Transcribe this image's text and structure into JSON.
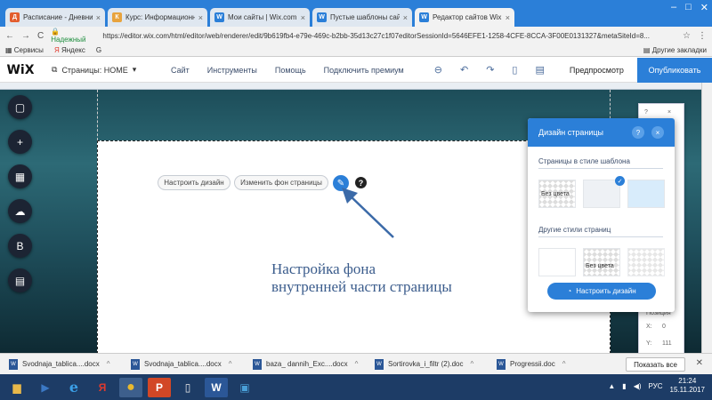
{
  "browser": {
    "tabs": [
      {
        "title": "Расписание - Дневник.р",
        "icon": "diary-icon",
        "color": "#e35d2e"
      },
      {
        "title": "Курс: Информационно",
        "icon": "course-icon",
        "color": "#e8a33d"
      },
      {
        "title": "Мои сайты | Wix.com",
        "icon": "wix-icon",
        "color": "#2b7fd8"
      },
      {
        "title": "Пустые шаблоны сайто",
        "icon": "wix-icon",
        "color": "#2b7fd8"
      },
      {
        "title": "Редактор сайтов Wix",
        "icon": "wix-icon",
        "color": "#2b7fd8",
        "active": true
      }
    ],
    "tab_close": "×",
    "window_controls": [
      "–",
      "□",
      "✕"
    ],
    "nav": {
      "back": "←",
      "forward": "→",
      "reload": "C"
    },
    "secure_label": "Надежный",
    "url": "https://editor.wix.com/html/editor/web/renderer/edit/9b619fb4-e79e-469c-b2bb-35d13c27c1f07editorSessionId=5646EFE1-1258-4CFE-8CCA-3F00E0131327&metaSiteId=8...",
    "star": "☆",
    "menu": "⋮",
    "bookmarks": {
      "apps": "Сервисы",
      "yandex": "Яндекс",
      "google": "G",
      "other": "Другие закладки"
    }
  },
  "wix": {
    "logo": "WiX",
    "pages_label": "Страницы: HOME",
    "pages_chevron": "▾",
    "menu": [
      "Сайт",
      "Инструменты",
      "Помощь",
      "Подключить премиум"
    ],
    "tools": [
      "⊖",
      "↶",
      "↷",
      "▯",
      "▤"
    ],
    "preview": "Предпросмотр",
    "publish": "Опубликовать"
  },
  "canvas": {
    "left_rail": [
      {
        "name": "background-tool-icon",
        "glyph": "▢"
      },
      {
        "name": "add-icon",
        "glyph": "+"
      },
      {
        "name": "app-market-icon",
        "glyph": "▦"
      },
      {
        "name": "upload-icon",
        "glyph": "☁"
      },
      {
        "name": "blog-icon",
        "glyph": "B"
      },
      {
        "name": "calendar-icon",
        "glyph": "▤"
      }
    ],
    "customize_design_pill": "Настроить дизайн",
    "change_bg_pill": "Изменить фон страницы",
    "edit_glyph": "✎",
    "help_glyph": "?",
    "annotation_line1": "Настройка фона",
    "annotation_line2": "внутренней части страницы",
    "accent": "#2b7fd8",
    "mini_panel": {
      "q": "?",
      "x": "×",
      "position": "Позиция",
      "x_label": "X:",
      "x_value": "0",
      "y_label": "Y:",
      "y_value": "111"
    }
  },
  "design_panel": {
    "title": "Дизайн страницы",
    "help": "?",
    "close": "×",
    "section1": "Страницы в стиле шаблона",
    "section2": "Другие стили страниц",
    "no_color_label": "Без цвета",
    "check": "✓",
    "button": "Настроить дизайн",
    "button_icon": "◔"
  },
  "downloads": {
    "items": [
      "Svodnaja_tablica....docx",
      "Svodnaja_tablica....docx",
      "baza_ dannih_Exc....docx",
      "Sortirovka_i_filtr (2).doc",
      "Progressii.doc"
    ],
    "chevron": "^",
    "show_all": "Показать все",
    "close": "✕"
  },
  "taskbar": {
    "apps": [
      {
        "name": "file-explorer-icon",
        "glyph": "▆",
        "color": "#e8b84a"
      },
      {
        "name": "media-player-icon",
        "glyph": "▶",
        "color": "#3b78c4"
      },
      {
        "name": "ie-icon",
        "glyph": "e",
        "color": "#3ba0e8"
      },
      {
        "name": "yandex-browser-icon",
        "glyph": "Я",
        "color": "#e03a2e"
      },
      {
        "name": "chrome-icon",
        "glyph": "●",
        "color": "#e8b92e"
      },
      {
        "name": "powerpoint-icon",
        "glyph": "P",
        "color": "#d24726"
      },
      {
        "name": "document-icon",
        "glyph": "▯",
        "color": "#e8e8e8"
      },
      {
        "name": "word-icon",
        "glyph": "W",
        "color": "#2b5797"
      },
      {
        "name": "image-viewer-icon",
        "glyph": "▣",
        "color": "#4aa0d8"
      }
    ],
    "lang": "РУС",
    "time": "21:24",
    "date": "15.11.2017"
  }
}
